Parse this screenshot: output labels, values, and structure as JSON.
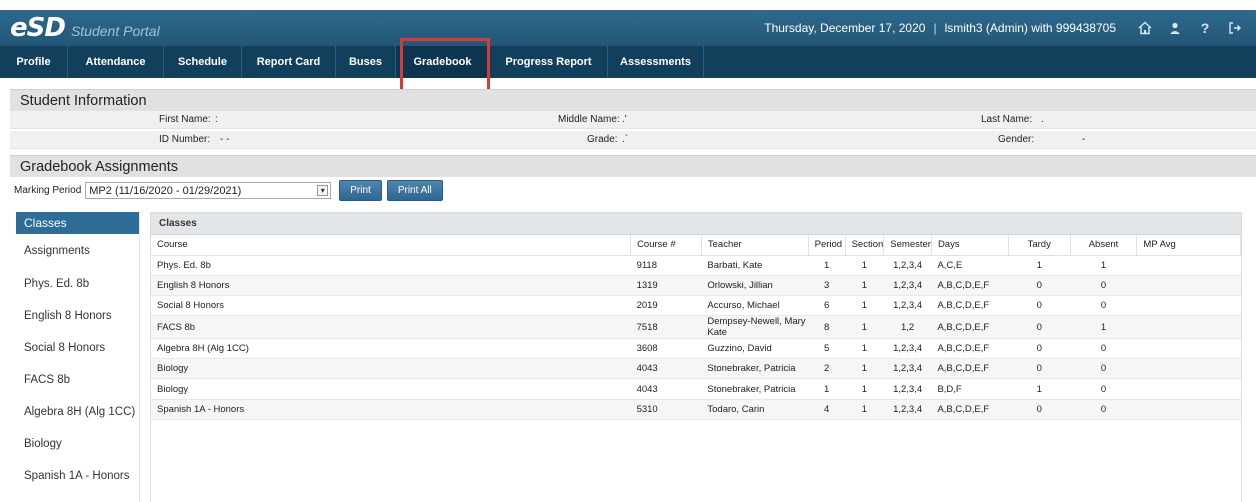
{
  "app": {
    "logo_mark": "eSD",
    "logo_text": "Student Portal",
    "date": "Thursday, December 17, 2020",
    "user": "lsmith3 (Admin) with 999438705"
  },
  "nav": [
    {
      "label": "Profile",
      "width": 0
    },
    {
      "label": "Attendance"
    },
    {
      "label": "Schedule"
    },
    {
      "label": "Report Card"
    },
    {
      "label": "Buses"
    },
    {
      "label": "Gradebook"
    },
    {
      "label": "Progress Report"
    },
    {
      "label": "Assessments"
    }
  ],
  "student_info": {
    "title": "Student Information",
    "first_name_label": "First Name:",
    "first_name_value": ":",
    "middle_name_label": "Middle Name:",
    "middle_name_value": ".'",
    "last_name_label": "Last Name:",
    "last_name_value": ".",
    "id_label": "ID Number:",
    "id_value": "- -",
    "grade_label": "Grade:",
    "grade_value": ".`",
    "gender_label": "Gender:",
    "gender_value": "-"
  },
  "gradebook": {
    "title": "Gradebook Assignments",
    "marking_period_label": "Marking Period",
    "marking_period_value": "MP2 (11/16/2020 - 01/29/2021)",
    "print_label": "Print",
    "print_all_label": "Print All"
  },
  "sidebar": {
    "header": "Classes",
    "items": [
      "Assignments",
      "Phys. Ed. 8b",
      "English 8 Honors",
      "Social 8 Honors",
      "FACS 8b",
      "Algebra 8H (Alg 1CC)",
      "Biology",
      "Spanish 1A - Honors"
    ]
  },
  "classes": {
    "title": "Classes",
    "columns": [
      "Course",
      "Course #",
      "Teacher",
      "Period",
      "Section",
      "Semester",
      "Days",
      "Tardy",
      "Absent",
      "MP Avg"
    ],
    "rows": [
      [
        "Phys. Ed. 8b",
        "9118",
        "Barbati, Kate",
        "1",
        "1",
        "1,2,3,4",
        "A,C,E",
        "1",
        "1",
        ""
      ],
      [
        "English 8 Honors",
        "1319",
        "Orlowski, Jillian",
        "3",
        "1",
        "1,2,3,4",
        "A,B,C,D,E,F",
        "0",
        "0",
        ""
      ],
      [
        "Social 8 Honors",
        "2019",
        "Accurso, Michael",
        "6",
        "1",
        "1,2,3,4",
        "A,B,C,D,E,F",
        "0",
        "0",
        ""
      ],
      [
        "FACS 8b",
        "7518",
        "Dempsey-Newell, Mary Kate",
        "8",
        "1",
        "1,2",
        "A,B,C,D,E,F",
        "0",
        "1",
        ""
      ],
      [
        "Algebra 8H (Alg 1CC)",
        "3608",
        "Guzzino, David",
        "5",
        "1",
        "1,2,3,4",
        "A,B,C,D,E,F",
        "0",
        "0",
        ""
      ],
      [
        "Biology",
        "4043",
        "Stonebraker, Patricia",
        "2",
        "1",
        "1,2,3,4",
        "A,B,C,D,E,F",
        "0",
        "0",
        ""
      ],
      [
        "Biology",
        "4043",
        "Stonebraker, Patricia",
        "1",
        "1",
        "1,2,3,4",
        "B,D,F",
        "1",
        "0",
        ""
      ],
      [
        "Spanish 1A - Honors",
        "5310",
        "Todaro, Carin",
        "4",
        "1",
        "1,2,3,4",
        "A,B,C,D,E,F",
        "0",
        "0",
        ""
      ]
    ]
  },
  "colors": {
    "topbar": "#2d6a8e",
    "nav": "#123f5b",
    "highlight": "#d63a3a",
    "button": "#2f6792"
  }
}
